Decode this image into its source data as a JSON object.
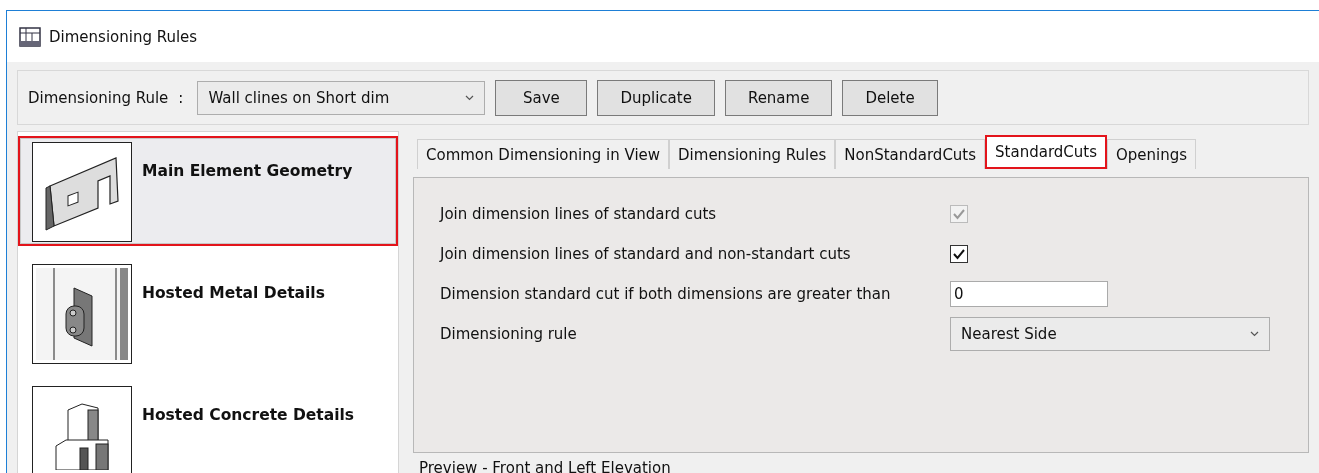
{
  "window": {
    "title": "Dimensioning Rules"
  },
  "toolbar": {
    "label": "Dimensioning Rule",
    "separator": ":",
    "rule_dropdown": {
      "value": "Wall clines on Short dim"
    },
    "buttons": [
      "Save",
      "Duplicate",
      "Rename",
      "Delete"
    ]
  },
  "sidebar": {
    "items": [
      {
        "label": "Main Element Geometry",
        "kind": "wall",
        "selected": true,
        "highlighted": true
      },
      {
        "label": "Hosted Metal Details",
        "kind": "metal",
        "selected": false,
        "highlighted": false
      },
      {
        "label": "Hosted Concrete Details",
        "kind": "concrete",
        "selected": false,
        "highlighted": false
      }
    ]
  },
  "tabs": [
    {
      "label": "Common Dimensioning in View",
      "selected": false,
      "highlighted": false
    },
    {
      "label": "Dimensioning Rules",
      "selected": false,
      "highlighted": false
    },
    {
      "label": "NonStandardCuts",
      "selected": false,
      "highlighted": false
    },
    {
      "label": "StandardCuts",
      "selected": true,
      "highlighted": true
    },
    {
      "label": "Openings",
      "selected": false,
      "highlighted": false
    }
  ],
  "settings": [
    {
      "label": "Join dimension lines of standard cuts",
      "kind": "checkbox",
      "checked": true,
      "disabled": true
    },
    {
      "label": "Join dimension lines of standard and non-standart cuts",
      "kind": "checkbox",
      "checked": true,
      "disabled": false
    },
    {
      "label": "Dimension standard cut if both dimensions are greater than",
      "kind": "text",
      "value": "0"
    },
    {
      "label": "Dimensioning rule",
      "kind": "dropdown",
      "value": "Nearest Side"
    }
  ],
  "preview": {
    "title": "Preview - Front and Left Elevation"
  }
}
